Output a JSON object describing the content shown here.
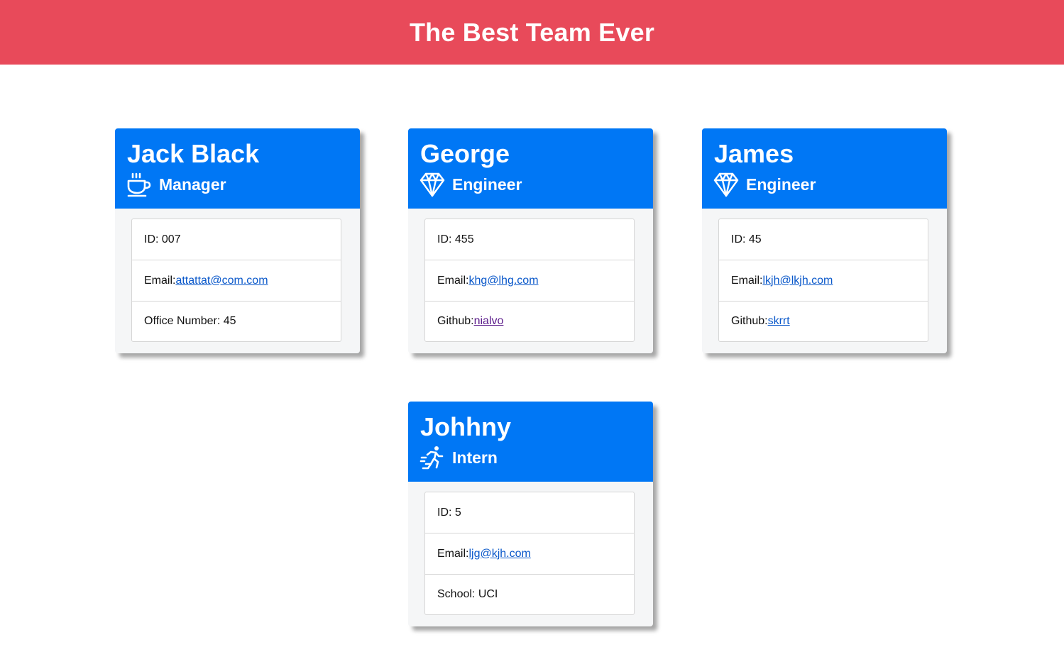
{
  "header": {
    "title": "The Best Team Ever"
  },
  "colors": {
    "header_bg": "#e84a5a",
    "card_header_bg": "#0077f5",
    "link": "#0a58ca",
    "visited_link": "#5a1a8a"
  },
  "cards": [
    {
      "name": "Jack Black",
      "role": "Manager",
      "icon": "coffee-cup-icon",
      "id_label": "ID: 007",
      "email_label": "Email:",
      "email": "attattat@com.com",
      "extra_label": "Office Number: 45"
    },
    {
      "name": "George",
      "role": "Engineer",
      "icon": "diamond-icon",
      "id_label": "ID: 455",
      "email_label": "Email:",
      "email": "khg@lhg.com",
      "extra_label": "Github:",
      "extra_link": "nialvo"
    },
    {
      "name": "James",
      "role": "Engineer",
      "icon": "diamond-icon",
      "id_label": "ID: 45",
      "email_label": "Email:",
      "email": "lkjh@lkjh.com",
      "extra_label": "Github:",
      "extra_link": "skrrt"
    },
    {
      "name": "Johhny",
      "role": "Intern",
      "icon": "running-person-icon",
      "id_label": "ID: 5",
      "email_label": "Email:",
      "email": "ljg@kjh.com",
      "extra_label": "School: UCI"
    }
  ]
}
